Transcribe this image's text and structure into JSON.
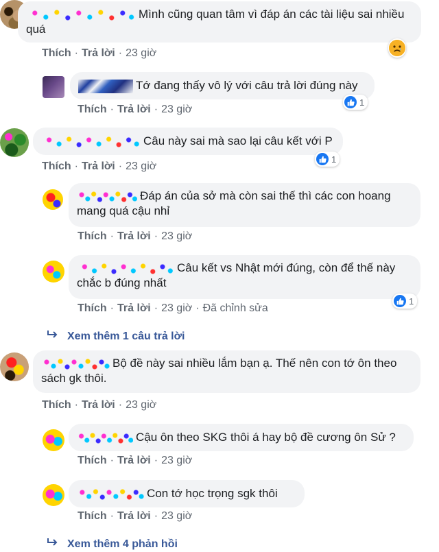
{
  "actions": {
    "like": "Thích",
    "reply": "Trả lời",
    "sep": "·",
    "edited": "Đã chỉnh sửa"
  },
  "comments": [
    {
      "text": "Mình cũng quan tâm vì đáp án các tài liệu sai nhiều quá",
      "time": "23 giờ"
    },
    {
      "text": "Tớ đang thấy vô lý với câu trả lời đúng này",
      "time": "23 giờ",
      "reaction_count": "1"
    },
    {
      "text": "Câu này sai mà sao lại câu kết với P",
      "time": "23 giờ",
      "reaction_count": "1"
    },
    {
      "text": "Đáp án của sở mà còn sai thế thì các con hoang mang quá cậu nhỉ",
      "time": "23 giờ"
    },
    {
      "text": "Câu kết vs Nhật mới đúng, còn để thế này chắc b đúng nhất",
      "time": "23 giờ",
      "reaction_count": "1"
    },
    {
      "text": "Bộ đề này sai nhiều lắm bạn ạ. Thế nên con tớ ôn theo sách gk thôi.",
      "time": "23 giờ"
    },
    {
      "text": "Cậu ôn theo SKG thôi á hay bộ đề cương ôn Sử ?",
      "time": "23 giờ"
    },
    {
      "text": "Con tớ học trọng sgk thôi",
      "time": "23 giờ"
    }
  ],
  "more_replies": [
    {
      "label": "Xem thêm 1 câu trả lời"
    },
    {
      "label": "Xem thêm 4 phản hồi"
    }
  ],
  "colors": {
    "link": "#385898",
    "like_blue": "#1877f2",
    "bubble": "#f2f3f5",
    "meta": "#606770"
  }
}
